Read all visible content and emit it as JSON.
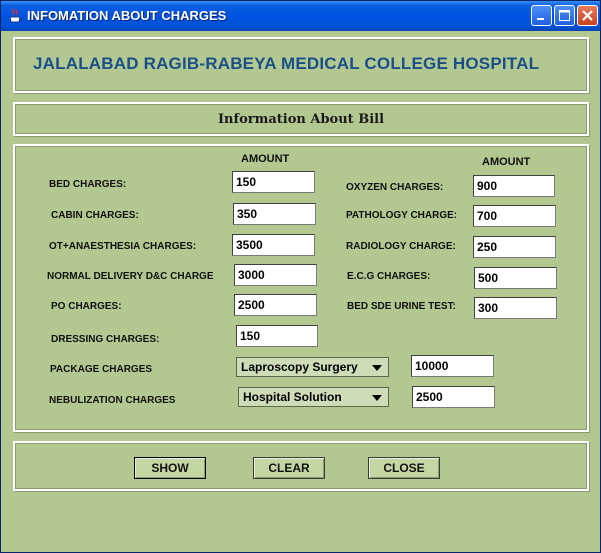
{
  "window": {
    "title": "INFOMATION ABOUT CHARGES",
    "accent": "#0053e1",
    "background": "#b2c890"
  },
  "header": {
    "hospital_name": "JALALABAD RAGIB-RABEYA MEDICAL COLLEGE HOSPITAL",
    "hospital_name_color": "#1a4f8a",
    "subtitle": "Information About Bill"
  },
  "form": {
    "left_amount_header": "AMOUNT",
    "right_amount_header": "AMOUNT",
    "left_rows": [
      {
        "label": "BED CHARGES:",
        "value": "150"
      },
      {
        "label": "CABIN CHARGES:",
        "value": "350"
      },
      {
        "label": "OT+ANAESTHESIA CHARGES:",
        "value": "3500"
      },
      {
        "label": "NORMAL DELIVERY D&C  CHARGE",
        "value": "3000"
      },
      {
        "label": "PO CHARGES:",
        "value": "2500"
      },
      {
        "label": "DRESSING CHARGES:",
        "value": "150"
      }
    ],
    "right_rows": [
      {
        "label": "OXYZEN CHARGES:",
        "value": "900"
      },
      {
        "label": "PATHOLOGY CHARGE:",
        "value": "700"
      },
      {
        "label": "RADIOLOGY CHARGE:",
        "value": "250"
      },
      {
        "label": "E.C.G CHARGES:",
        "value": "500"
      },
      {
        "label": "BED SDE URINE TEST:",
        "value": "300"
      }
    ],
    "package": {
      "label": "PACKAGE CHARGES",
      "selected": "Laproscopy Surgery",
      "value": "10000"
    },
    "nebulization": {
      "label": "NEBULIZATION CHARGES",
      "selected": "Hospital Solution",
      "value": "2500"
    }
  },
  "buttons": {
    "show": "SHOW",
    "clear": "CLEAR",
    "close": "CLOSE"
  }
}
